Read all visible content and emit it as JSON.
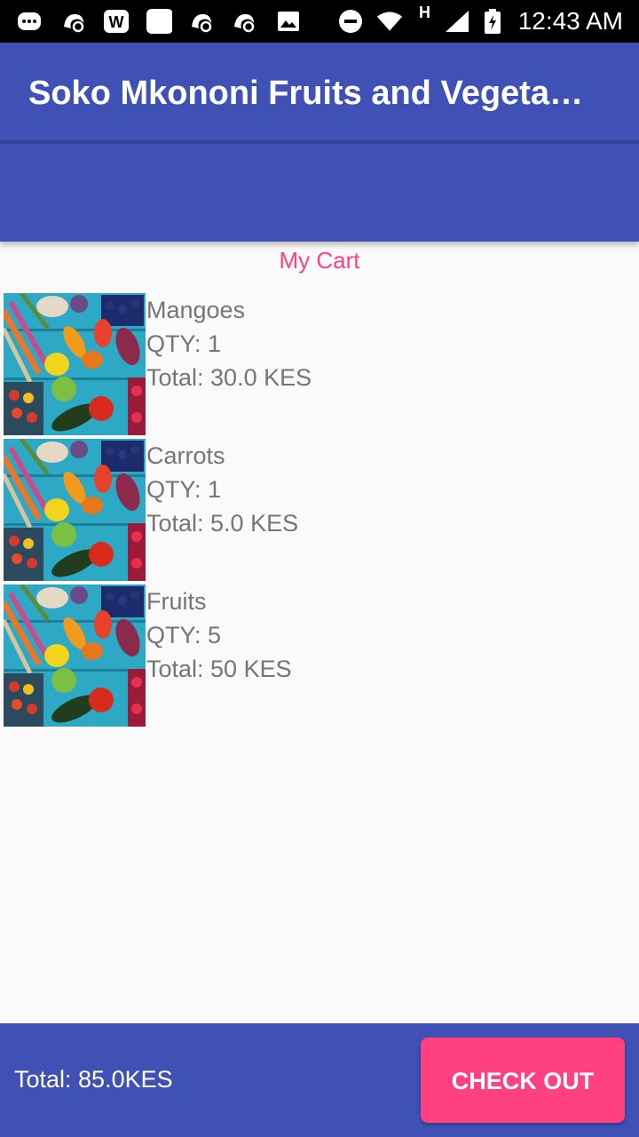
{
  "status_bar": {
    "time": "12:43 AM",
    "network_indicator": "H",
    "left_icons": [
      "more-notifications-icon",
      "uc-browser-icon",
      "w-app-icon",
      "blank-app-icon",
      "uc-browser-icon",
      "uc-browser-icon",
      "gallery-icon"
    ],
    "right_icons": [
      "do-not-disturb-icon",
      "wifi-icon",
      "signal-icon",
      "battery-charging-icon"
    ]
  },
  "app_bar": {
    "title": "Soko Mkononi Fruits and Vegetables",
    "color": "#3f51b5"
  },
  "cart": {
    "heading": "My Cart",
    "heading_color": "#ff4081",
    "items": [
      {
        "name": "Mangoes",
        "qty": "QTY: 1",
        "total": "Total: 30.0 KES",
        "image": "vegetables-photo"
      },
      {
        "name": "Carrots",
        "qty": "QTY: 1",
        "total": "Total: 5.0 KES",
        "image": "vegetables-photo"
      },
      {
        "name": "Fruits",
        "qty": "QTY: 5",
        "total": "Total: 50 KES",
        "image": "vegetables-photo"
      }
    ]
  },
  "bottom_bar": {
    "total": "Total: 85.0KES",
    "checkout_label": "CHECK OUT",
    "accent": "#ff4081"
  }
}
